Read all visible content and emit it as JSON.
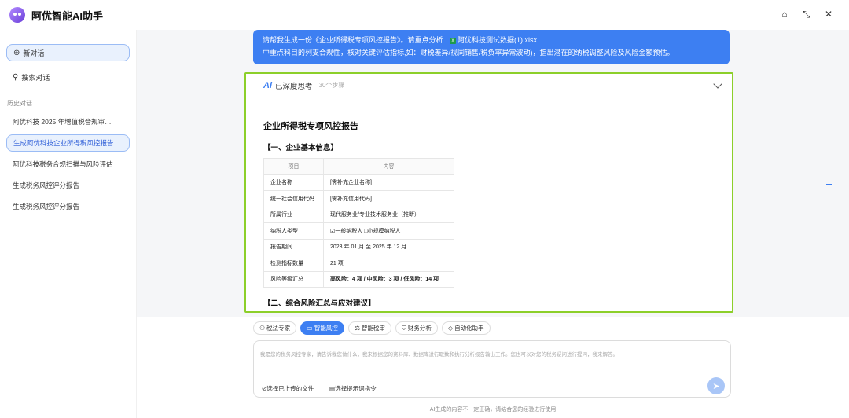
{
  "app": {
    "title": "阿优智能AI助手",
    "window_icons": [
      "home-icon",
      "shrink-icon",
      "close-icon"
    ]
  },
  "sidebar": {
    "new_chat": "新对话",
    "search": "搜索对话",
    "history_label": "历史对话",
    "items": [
      {
        "label": "阿优科技 2025 年增值税合规审…",
        "active": false
      },
      {
        "label": "生成阿优科技企业所得税风控报告",
        "active": true
      },
      {
        "label": "阿优科技税务合规扫描与风险评估",
        "active": false
      },
      {
        "label": "生成税务风控评分报告",
        "active": false
      },
      {
        "label": "生成税务风控评分报告",
        "active": false
      }
    ]
  },
  "chat": {
    "user_line1": "请帮我生成一份《企业所得税专项风控报告》。请重点分析",
    "file_name": "阿优科技测试数据(1).xlsx",
    "user_line2": "中重点科目的列支合规性，核对关键评估指标,如：财税差异/视同销售/税负率异常波动)，指出潜在的纳税调整风险及风险金额预估。",
    "think_label": "已深度思考",
    "think_steps": "30个步骤",
    "report_title": "企业所得税专项风控报告",
    "section1": "【一、企业基本信息】",
    "table_headers": [
      "项目",
      "内容"
    ],
    "table_rows": [
      {
        "k": "企业名称",
        "v": "[需补充企业名称]"
      },
      {
        "k": "统一社会信用代码",
        "v": "[需补充信用代码]"
      },
      {
        "k": "所属行业",
        "v": "现代服务业/专业技术服务业（推断）"
      },
      {
        "k": "纳税人类型",
        "v": "☑一般纳税人 □小规模纳税人"
      },
      {
        "k": "报告期间",
        "v": "2023 年 01 月 至 2025 年 12 月"
      },
      {
        "k": "检测指标数量",
        "v": "21 项"
      },
      {
        "k": "风险等级汇总",
        "v": "高风险：4 项 / 中风险：3 项 / 低风险：14 项"
      }
    ],
    "section2": "【二、综合风险汇总与应对建议】"
  },
  "tools": [
    {
      "icon": "person-icon",
      "label": "税法专家",
      "active": false
    },
    {
      "icon": "chat-icon",
      "label": "智能风控",
      "active": true
    },
    {
      "icon": "scale-icon",
      "label": "智能税审",
      "active": false
    },
    {
      "icon": "shield-icon",
      "label": "财务分析",
      "active": false
    },
    {
      "icon": "tag-icon",
      "label": "自动化助手",
      "active": false
    }
  ],
  "input": {
    "placeholder": "我是您的税务风控专家，请告诉我您做什么，我来根据您的资料库、数据库进行取数和执行分析报告输出工作。您也可以对您的税务疑问进行提问，我来解答。",
    "attach": "选择已上传的文件",
    "prompts": "选择提示词指令"
  },
  "disclaimer": "AI生成的内容不一定正确，请结合您的经验进行使用",
  "colors": {
    "accent": "#3d7ff2",
    "highlight_border": "#8ccf2a"
  }
}
